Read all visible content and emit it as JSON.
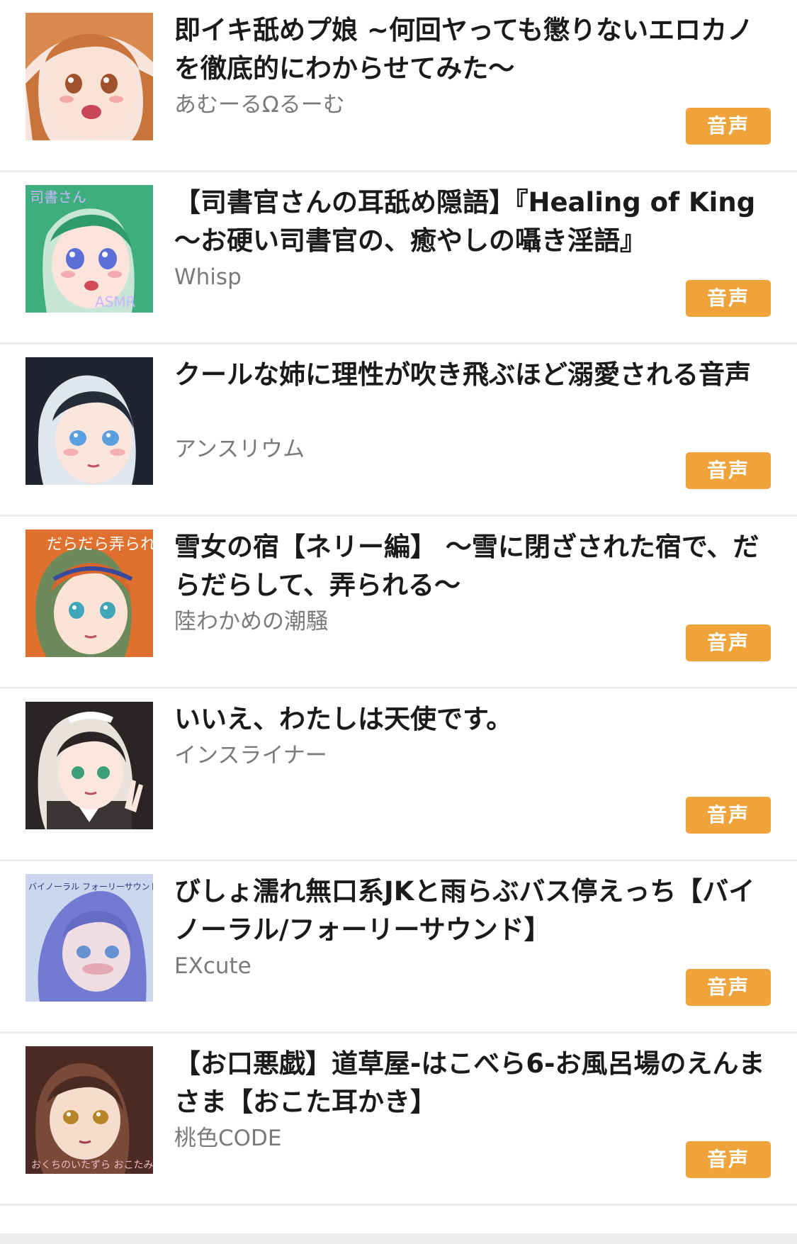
{
  "colors": {
    "badge": "#f0a33b",
    "title": "#1a1a1a",
    "circle": "#7a7a7a",
    "divider": "#ececec"
  },
  "items": [
    {
      "title": "即イキ舐めプ娘 ~何回ヤっても懲りないエロカノを徹底的にわからせてみた〜",
      "circle": "あむーるΩるーむ",
      "badge": "音声",
      "thumb_icon": "anime-girl-cover-art",
      "thumb_text": ""
    },
    {
      "title": "【司書官さんの耳舐め隠語】『Healing of King～お硬い司書官の、癒やしの囁き淫語』",
      "circle": "Whisp",
      "badge": "音声",
      "thumb_icon": "anime-girl-cover-art",
      "thumb_text": "司書さん",
      "thumb_text2": "ASMR"
    },
    {
      "title": "クールな姉に理性が吹き飛ぶほど溺愛される音声",
      "circle": "アンスリウム",
      "badge": "音声",
      "thumb_icon": "anime-girl-cover-art",
      "thumb_text": ""
    },
    {
      "title": "雪女の宿【ネリー編】 ～雪に閉ざされた宿で、だらだらして、弄られる～",
      "circle": "陸わかめの潮騒",
      "badge": "音声",
      "thumb_icon": "anime-girl-cover-art",
      "thumb_text": "だらだら弄られ"
    },
    {
      "title": "いいえ、わたしは天使です。",
      "circle": "インスライナー",
      "badge": "音声",
      "thumb_icon": "anime-girl-cover-art",
      "thumb_text": ""
    },
    {
      "title": "びしょ濡れ無口系JKと雨らぶバス停えっち【バイノーラル/フォーリーサウンド】",
      "circle": "EXcute",
      "badge": "音声",
      "thumb_icon": "anime-girl-cover-art",
      "thumb_text": "バイノーラル フォーリーサウンド"
    },
    {
      "title": "【お口悪戯】道草屋-はこべら6-お風呂場のえんまさま【おこた耳かき】",
      "circle": "桃色CODE",
      "badge": "音声",
      "thumb_icon": "anime-girl-cover-art",
      "thumb_text": "おくちのいたずら おこたみみかき"
    }
  ]
}
